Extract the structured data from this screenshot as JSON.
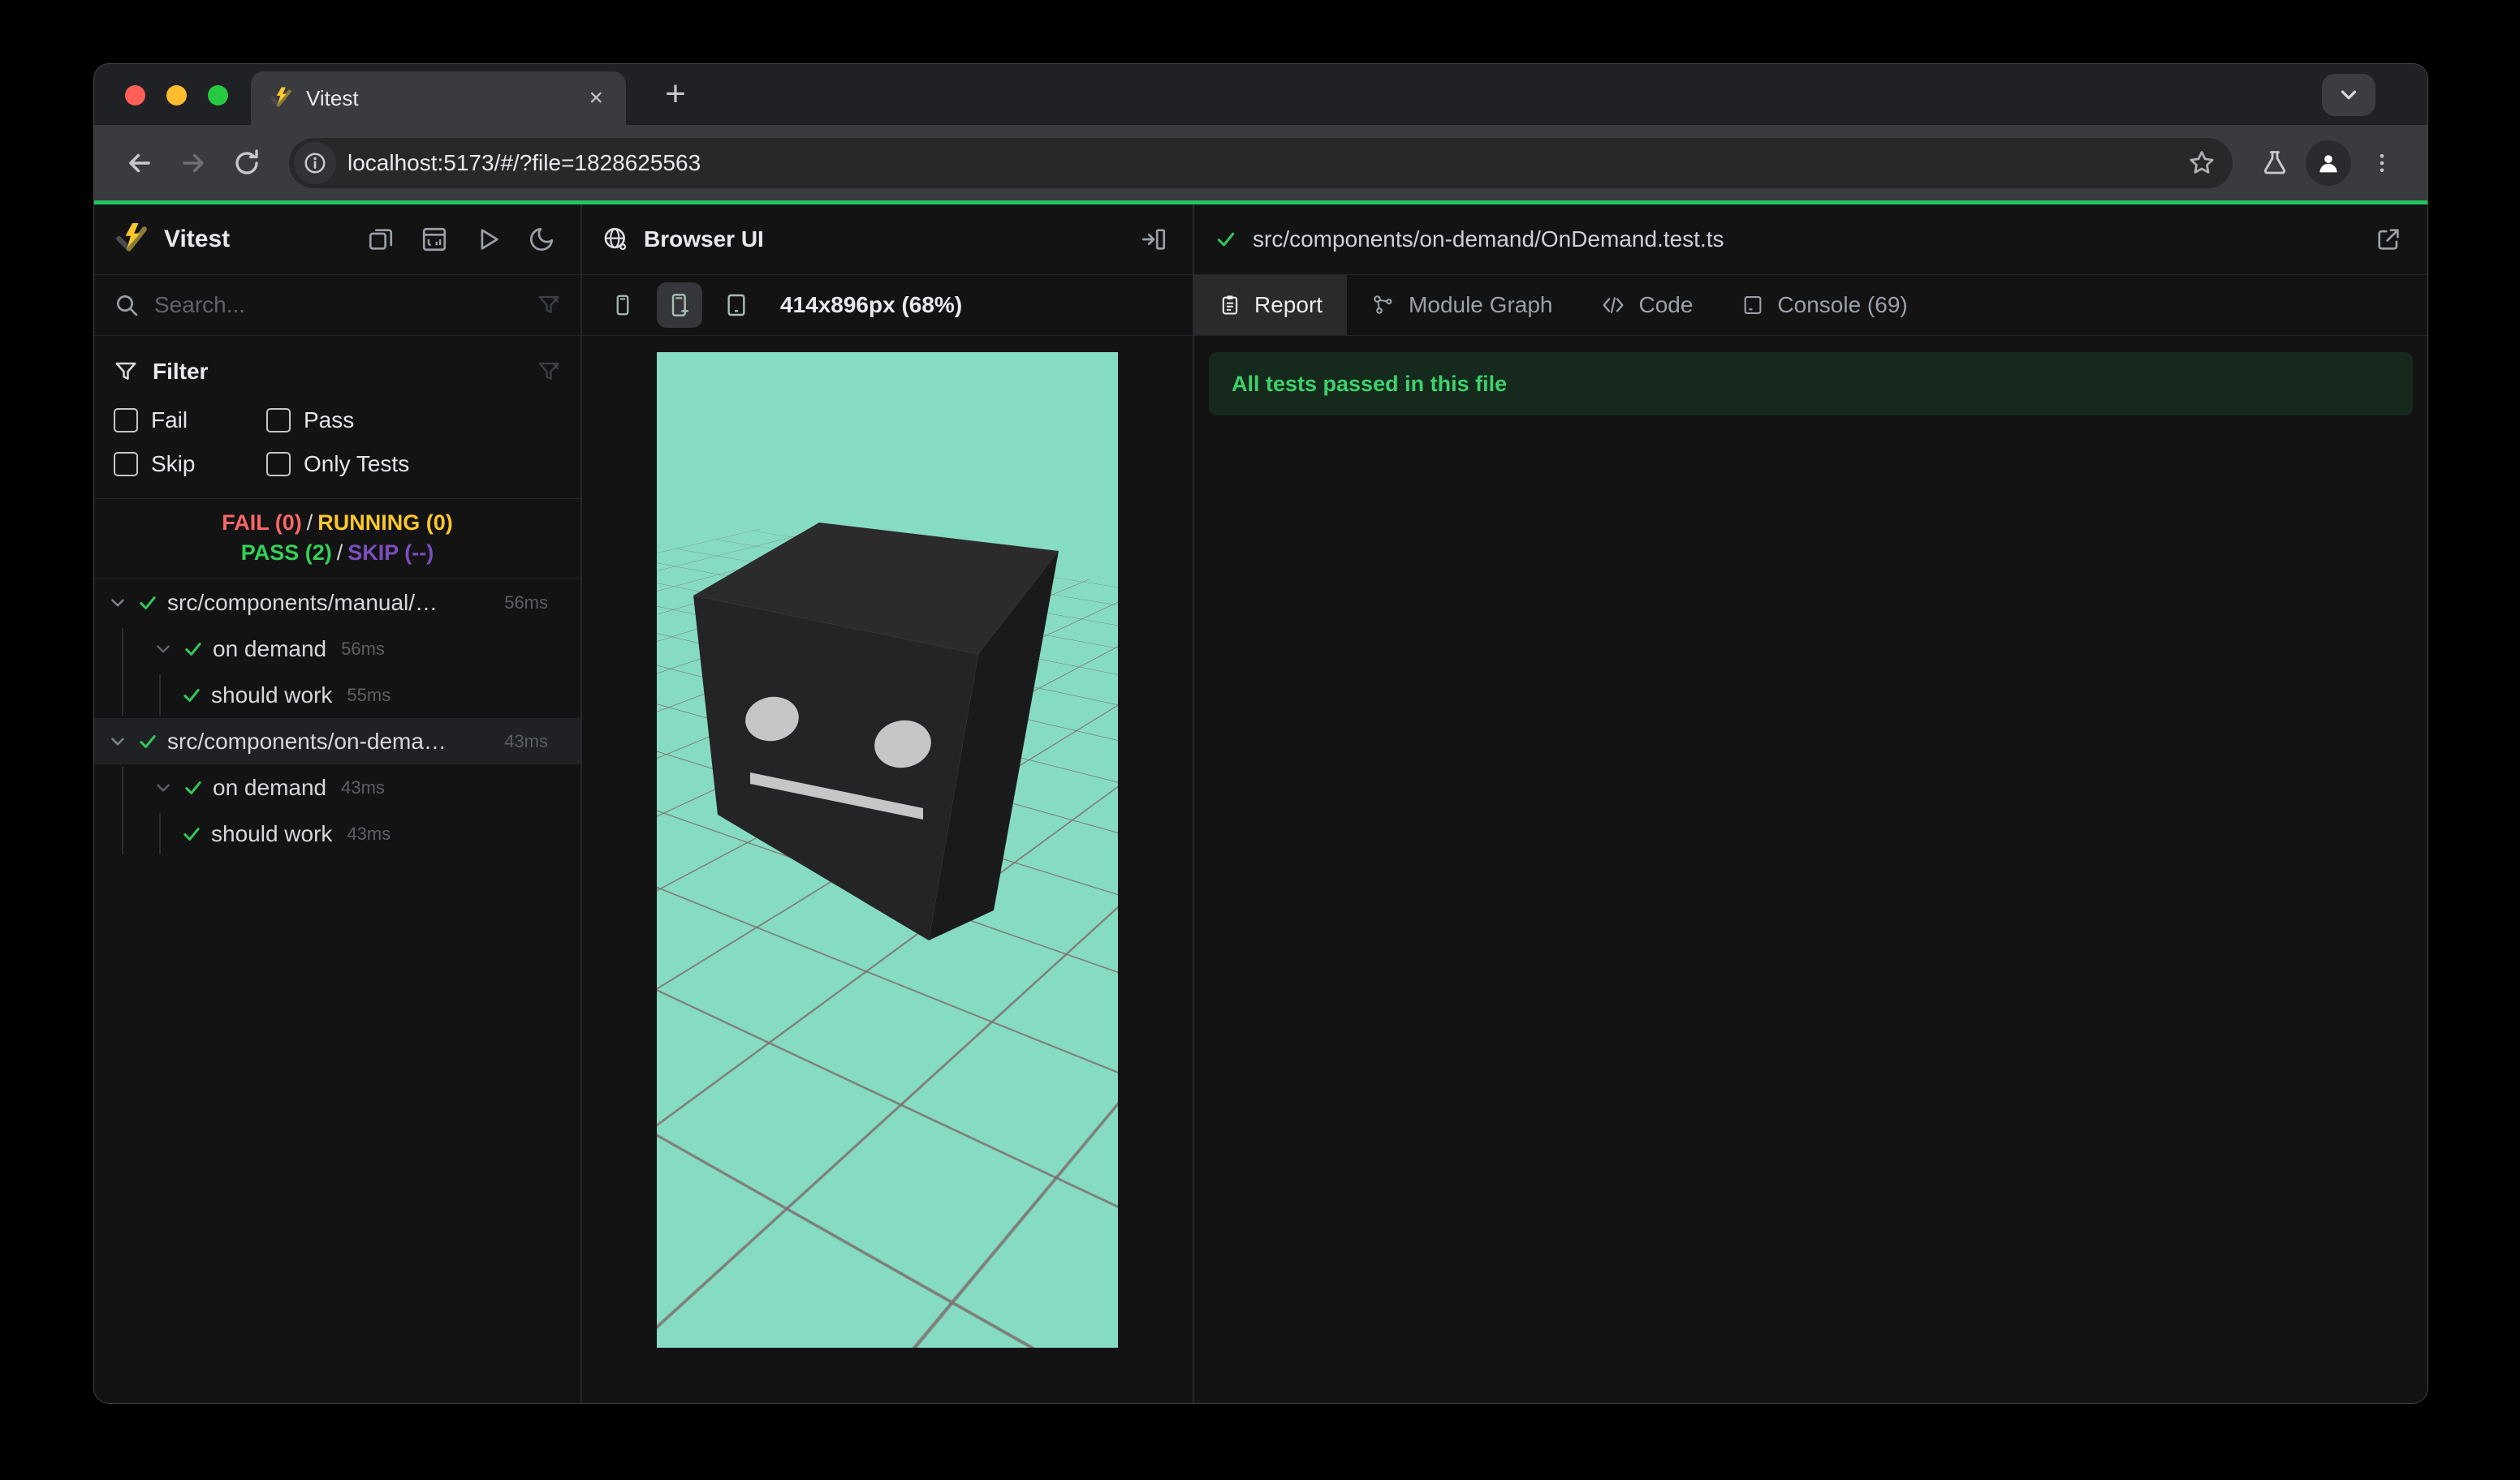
{
  "window": {
    "tab_title": "Vitest",
    "url": "localhost:5173/#/?file=1828625563"
  },
  "sidebar": {
    "app_title": "Vitest",
    "search_placeholder": "Search...",
    "filter": {
      "title": "Filter",
      "options": [
        "Fail",
        "Pass",
        "Skip",
        "Only Tests"
      ]
    },
    "summary": {
      "fail": "FAIL (0)",
      "running": "RUNNING (0)",
      "pass": "PASS (2)",
      "skip": "SKIP (--)",
      "sep": "/"
    },
    "tree": [
      {
        "label": "src/components/manual/…",
        "duration": "56ms"
      },
      {
        "label": "on demand",
        "duration": "56ms"
      },
      {
        "label": "should work",
        "duration": "55ms"
      },
      {
        "label": "src/components/on-dema…",
        "duration": "43ms"
      },
      {
        "label": "on demand",
        "duration": "43ms"
      },
      {
        "label": "should work",
        "duration": "43ms"
      }
    ]
  },
  "preview": {
    "title": "Browser UI",
    "size_label": "414x896px (68%)"
  },
  "report": {
    "file_path": "src/components/on-demand/OnDemand.test.ts",
    "tabs": [
      "Report",
      "Module Graph",
      "Code",
      "Console (69)"
    ],
    "banner": "All tests passed in this file"
  },
  "colors": {
    "accent_green": "#22c55e",
    "pass_green": "#34d058",
    "fail_red": "#fb6666",
    "running_yellow": "#fcc72b",
    "skip_purple": "#7c4dbc",
    "viewport_mint": "#86dcc3",
    "banner_bg": "#152a1d",
    "banner_text": "#3fd06b"
  }
}
